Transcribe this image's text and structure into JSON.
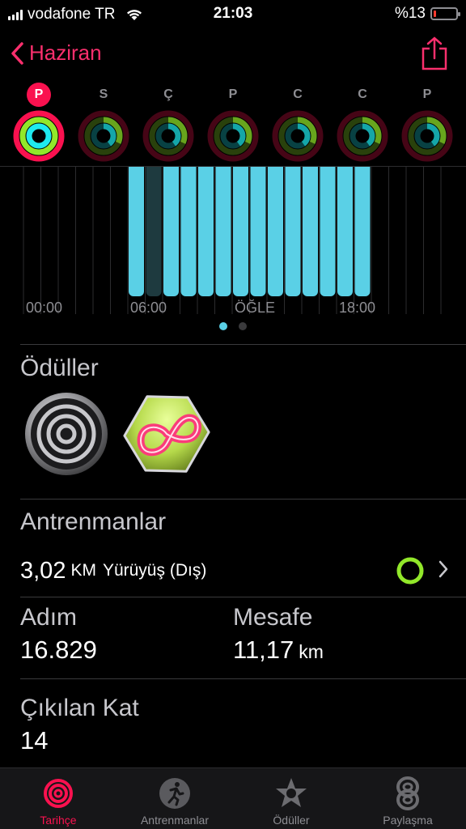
{
  "status": {
    "carrier": "vodafone TR",
    "time": "21:03",
    "battery_text": "%13",
    "battery_level": 0.13
  },
  "nav": {
    "back_label": "Haziran"
  },
  "week": {
    "days": [
      {
        "letter": "P",
        "selected": true
      },
      {
        "letter": "S",
        "selected": false
      },
      {
        "letter": "Ç",
        "selected": false
      },
      {
        "letter": "P",
        "selected": false
      },
      {
        "letter": "C",
        "selected": false
      },
      {
        "letter": "C",
        "selected": false
      },
      {
        "letter": "P",
        "selected": false
      }
    ]
  },
  "chart_data": {
    "type": "bar",
    "x_ticks": [
      "00:00",
      "06:00",
      "ÖĞLE",
      "18:00"
    ],
    "bar_color": "#5ad0e6",
    "highlight_color": "#1e3a3f",
    "active_from_hour": 6.5,
    "active_hours_count": 14,
    "highlighted_hour_index": 1,
    "values": [
      1,
      1,
      1,
      1,
      1,
      1,
      1,
      1,
      1,
      1,
      1,
      1,
      1,
      1
    ]
  },
  "pager": {
    "pages": 2,
    "active": 0
  },
  "awards": {
    "title": "Ödüller",
    "items": [
      {
        "icon": "rings-award-icon"
      },
      {
        "icon": "infinity-award-icon"
      }
    ]
  },
  "workouts": {
    "title": "Antrenmanlar",
    "items": [
      {
        "value": "3,02",
        "unit": "KM",
        "name": "Yürüyüş (Dış)"
      }
    ]
  },
  "stats": {
    "steps": {
      "label": "Adım",
      "value": "16.829"
    },
    "distance": {
      "label": "Mesafe",
      "value": "11,17",
      "unit": "km"
    },
    "floors": {
      "label": "Çıkılan Kat",
      "value": "14"
    }
  },
  "tabs": [
    {
      "label": "Tarihçe",
      "active": true,
      "icon": "history-rings-icon"
    },
    {
      "label": "Antrenmanlar",
      "active": false,
      "icon": "runner-icon"
    },
    {
      "label": "Ödüller",
      "active": false,
      "icon": "star-award-icon"
    },
    {
      "label": "Paylaşma",
      "active": false,
      "icon": "sharing-icon"
    }
  ],
  "colors": {
    "accent": "#fa114f",
    "move": "#fa114f",
    "exercise": "#92e82a",
    "stand": "#1eeaef"
  }
}
